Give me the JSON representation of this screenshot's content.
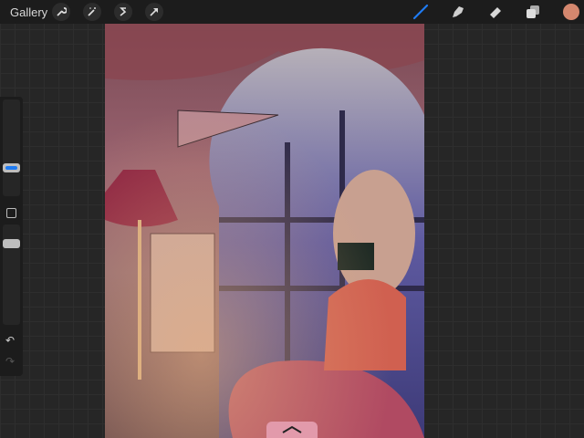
{
  "topbar": {
    "gallery_label": "Gallery",
    "left_tools": [
      "wrench-icon",
      "magic-wand-icon",
      "selection-icon",
      "transform-arrow-icon"
    ],
    "right_tools": [
      "brush-icon",
      "smudge-icon",
      "eraser-icon",
      "layers-icon"
    ],
    "current_color": "#d4876e",
    "active_tool_color": "#1f7bf2"
  },
  "sidebar": {
    "brush_size_fraction": 0.27,
    "opacity_fraction": 0.84
  }
}
